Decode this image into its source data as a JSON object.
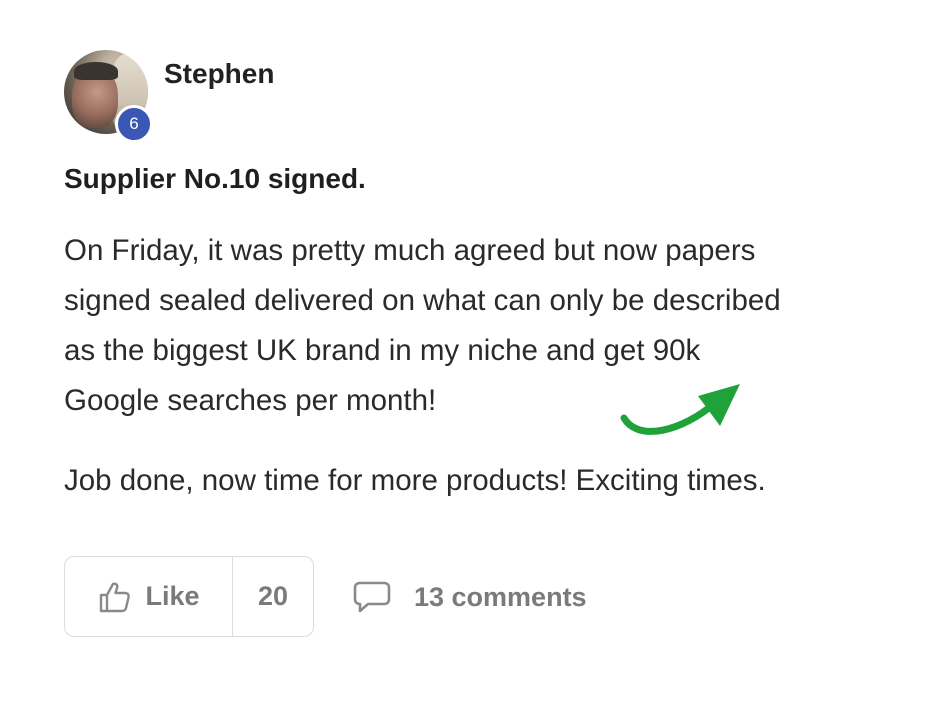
{
  "author": {
    "name": "Stephen",
    "level": "6",
    "avatar_icon": "avatar-photo"
  },
  "post": {
    "title": "Supplier No.10 signed.",
    "body_lines": [
      "On Friday, it was pretty much agreed but now papers",
      "signed sealed delivered on what can only be described",
      "as the biggest UK brand in my niche and get 90k",
      "Google searches per month!"
    ],
    "body_second": "Job done, now time for more products! Exciting times."
  },
  "annotation": {
    "icon": "green-arrow-icon",
    "color": "#1fa23a"
  },
  "actions": {
    "like_label": "Like",
    "like_count": "20",
    "like_icon": "thumbs-up-icon",
    "comments_label": "13 comments",
    "comments_icon": "speech-bubble-icon"
  },
  "colors": {
    "badge": "#3a57b6",
    "text": "#2a2a2a",
    "muted": "#7a7a7a",
    "border": "#dcdcdc"
  }
}
